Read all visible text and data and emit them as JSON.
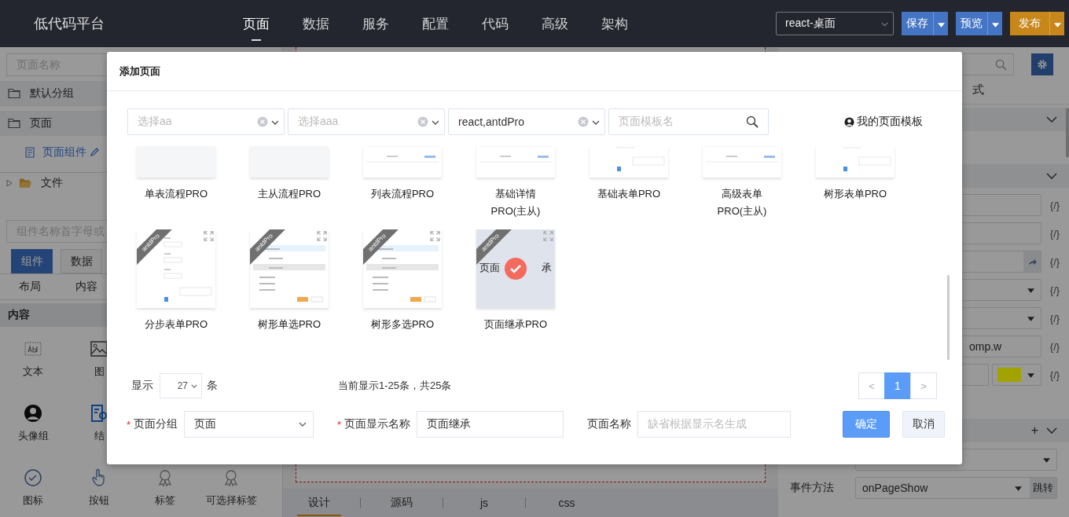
{
  "header": {
    "logo": "低代码平台",
    "nav": [
      {
        "label": "页面",
        "selected": true
      },
      {
        "label": "数据",
        "selected": false
      },
      {
        "label": "服务",
        "selected": false
      },
      {
        "label": "配置",
        "selected": false
      },
      {
        "label": "代码",
        "selected": false
      },
      {
        "label": "高级",
        "selected": false
      },
      {
        "label": "架构",
        "selected": false
      }
    ],
    "platform": "react-桌面",
    "buttons": [
      {
        "label": "保存",
        "kind": "blue"
      },
      {
        "label": "预览",
        "kind": "blue"
      },
      {
        "label": "发布",
        "kind": "orange"
      }
    ]
  },
  "left_panel": {
    "search_placeholder": "页面名称",
    "groups": [
      {
        "label": "默认分组"
      },
      {
        "label": "页面"
      }
    ],
    "page_item": "页面组件",
    "tree": [
      {
        "label": "文件",
        "expanded": false
      }
    ],
    "component_search_placeholder": "组件名称首字母或",
    "tabs": [
      {
        "label": "组件",
        "selected": true
      },
      {
        "label": "数据",
        "selected": false
      }
    ],
    "subtabs": [
      "布局",
      "内容"
    ],
    "section": "内容",
    "component_rows": [
      [
        {
          "label": "文本"
        },
        {
          "label": "图"
        }
      ],
      [
        {
          "label": "头像组"
        },
        {
          "label": "结"
        }
      ],
      [
        {
          "label": "图标"
        },
        {
          "label": "按钮"
        },
        {
          "label": "标签"
        },
        {
          "label": "可选择标签"
        }
      ]
    ]
  },
  "center_panel": {
    "tabs": [
      {
        "label": "设计",
        "selected": true
      },
      {
        "label": "源码",
        "selected": false
      },
      {
        "label": "js",
        "selected": false
      },
      {
        "label": "css",
        "selected": false
      }
    ]
  },
  "right_panel": {
    "tab_label": "式",
    "rows": [
      {
        "kind": "section"
      },
      {
        "kind": "section"
      },
      {
        "kind": "input",
        "code": "{/}"
      },
      {
        "kind": "input",
        "code": "{/}"
      },
      {
        "kind": "link",
        "code": "{/}"
      },
      {
        "kind": "select",
        "code": "{/}"
      },
      {
        "kind": "select",
        "code": "{/}"
      },
      {
        "kind": "input",
        "value": "omp.w",
        "code": "{/}"
      },
      {
        "kind": "color",
        "color": "#a3a300",
        "code": "{/}"
      },
      {
        "kind": "section",
        "add": "+"
      },
      {
        "kind": "select"
      },
      {
        "kind": "select",
        "label": "事件方法",
        "value": "onPageShow",
        "action": "跳转"
      }
    ]
  },
  "modal": {
    "title": "添加页面",
    "filters": [
      {
        "kind": "select",
        "placeholder": "选择aa",
        "clearable": true
      },
      {
        "kind": "select",
        "placeholder": "选择aaa",
        "clearable": true
      },
      {
        "kind": "select",
        "value": "react,antdPro",
        "clearable": true
      },
      {
        "kind": "search",
        "placeholder": "页面模板名"
      }
    ],
    "my_templates": "我的页面模板",
    "templates": [
      {
        "name": [
          "单表流程PRO"
        ],
        "kind": "blank",
        "selected": false
      },
      {
        "name": [
          "主从流程PRO"
        ],
        "kind": "blank",
        "selected": false
      },
      {
        "name": [
          "列表流程PRO"
        ],
        "kind": "table",
        "selected": false
      },
      {
        "name": [
          "基础详情",
          "PRO(主从)"
        ],
        "kind": "table",
        "selected": false
      },
      {
        "name": [
          "基础表单PRO"
        ],
        "kind": "form",
        "selected": false
      },
      {
        "name": [
          "高级表单",
          "PRO(主从)"
        ],
        "kind": "table",
        "selected": false
      },
      {
        "name": [
          "树形表单PRO"
        ],
        "kind": "form",
        "selected": false
      },
      {
        "name": [
          "分步表单PRO"
        ],
        "kind": "form",
        "ribbon": "antdPro",
        "selected": false
      },
      {
        "name": [
          "树形单选PRO"
        ],
        "kind": "tree",
        "ribbon": "antdPro",
        "selected": false
      },
      {
        "name": [
          "树形多选PRO"
        ],
        "kind": "tree",
        "ribbon": "antdPro",
        "selected": false
      },
      {
        "name": [
          "页面继承PRO"
        ],
        "kind": "text",
        "preview_texts": [
          "页面",
          "承"
        ],
        "ribbon": "antdPro",
        "selected": true
      }
    ],
    "page_size_label": "显示",
    "page_size": "27",
    "page_size_unit": "条",
    "summary": "当前显示1-25条，共25条",
    "pagination": {
      "prev": "<",
      "pages": [
        {
          "label": "1",
          "selected": true
        }
      ],
      "next": ">"
    },
    "form": [
      {
        "mark": "*",
        "label": "页面分组",
        "kind": "select",
        "value": "页面"
      },
      {
        "mark": "*",
        "label": "页面显示名称",
        "kind": "input",
        "value": "页面继承"
      },
      {
        "label": "页面名称",
        "kind": "input",
        "placeholder": "缺省根据显示名生成"
      }
    ],
    "buttons": [
      {
        "label": "确定",
        "kind": "primary"
      },
      {
        "label": "取消",
        "kind": "default"
      }
    ]
  }
}
